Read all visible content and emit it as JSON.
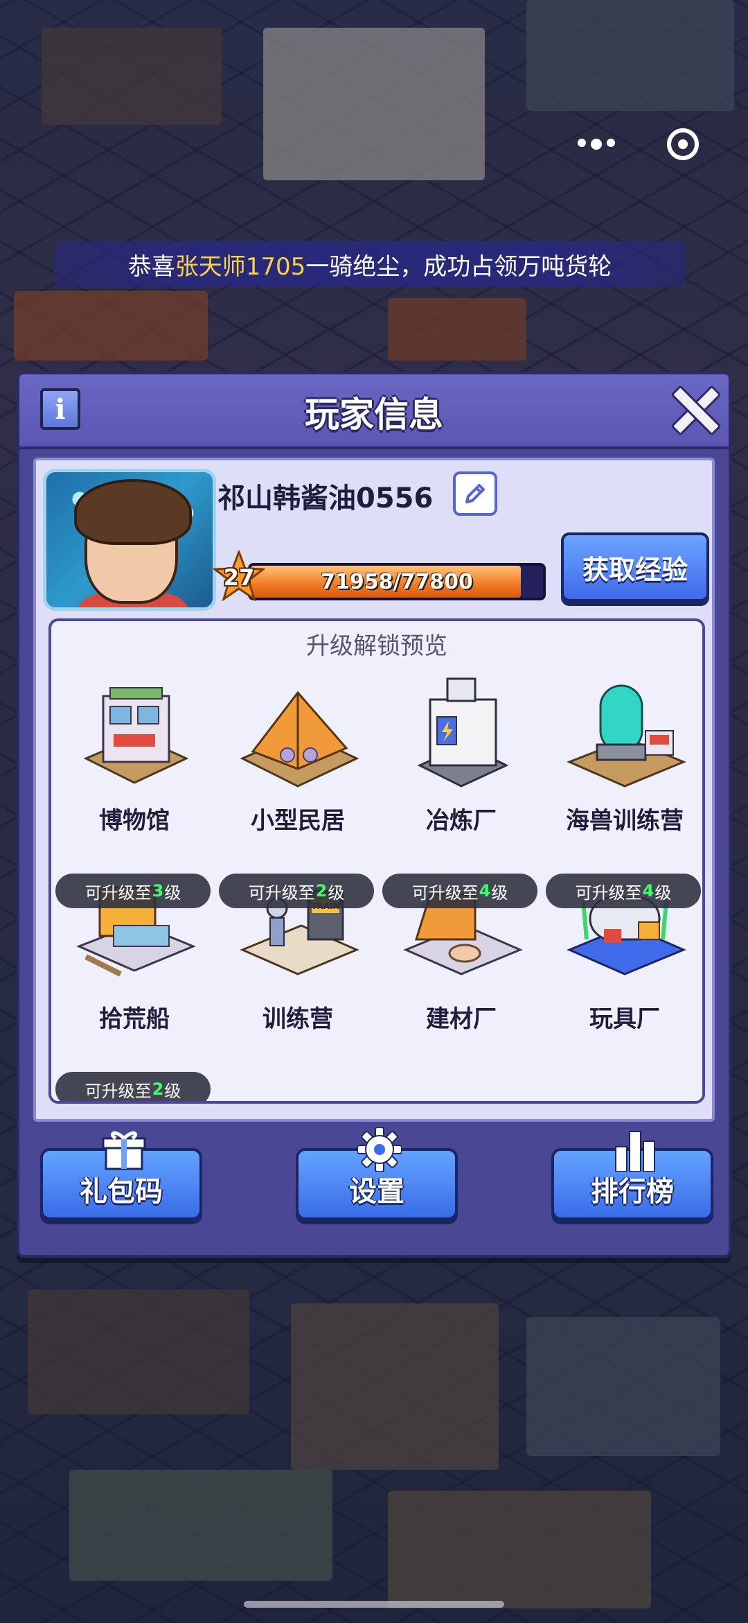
{
  "marquee": {
    "prefix": "恭喜 ",
    "player": "张天师1705",
    "suffix": "一骑绝尘，成功占领万吨货轮"
  },
  "capsule": {
    "more_icon": "more-dots-icon",
    "close_icon": "target-icon"
  },
  "panel": {
    "title": "玩家信息",
    "info_label": "i"
  },
  "profile": {
    "username": "祁山韩酱油0556",
    "level": "27",
    "xp_text": "71958/77800",
    "xp_progress": 0.925,
    "get_xp_label": "获取经验"
  },
  "preview": {
    "title": "升级解锁预览",
    "items": [
      {
        "name": "博物馆"
      },
      {
        "name": "小型民居"
      },
      {
        "name": "冶炼厂"
      },
      {
        "name": "海兽训练营"
      },
      {
        "name": "拾荒船",
        "badge_prefix": "可升级至",
        "badge_level": "3",
        "badge_suffix": "级"
      },
      {
        "name": "训练营",
        "badge_prefix": "可升级至",
        "badge_level": "2",
        "badge_suffix": "级"
      },
      {
        "name": "建材厂",
        "badge_prefix": "可升级至",
        "badge_level": "4",
        "badge_suffix": "级"
      },
      {
        "name": "玩具厂",
        "badge_prefix": "可升级至",
        "badge_level": "4",
        "badge_suffix": "级"
      }
    ],
    "last_badge": {
      "prefix": "可升级至",
      "level": "2",
      "suffix": "级"
    }
  },
  "bottom": {
    "gift_label": "礼包码",
    "settings_label": "设置",
    "rank_label": "排行榜"
  },
  "colors": {
    "accent_blue": "#3f6bea",
    "panel_purple": "#4a4794",
    "level_green": "#3dff6b",
    "highlight_yellow": "#ffd23f"
  }
}
